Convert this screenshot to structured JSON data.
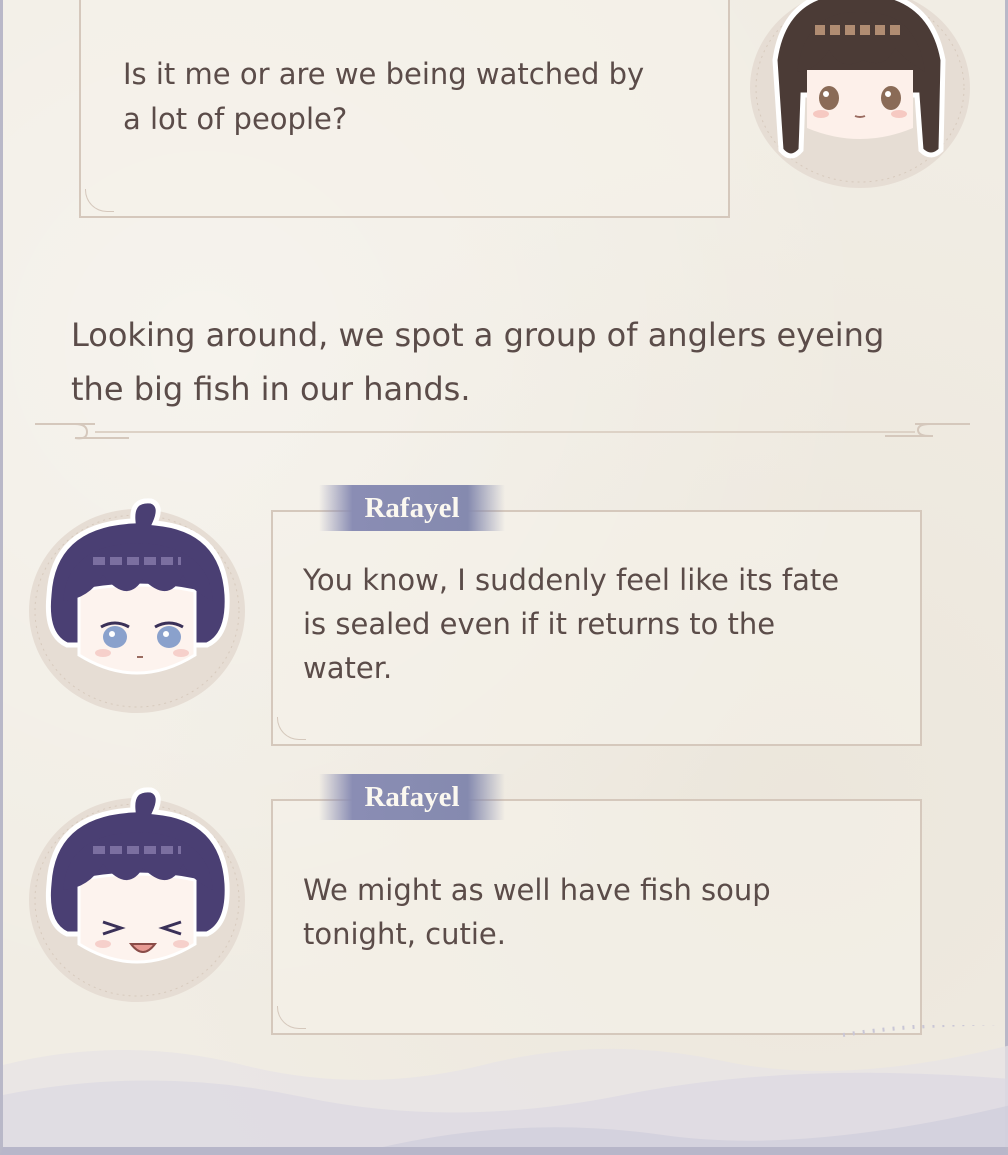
{
  "conversation": {
    "player_line": {
      "text_line_1": "Is it me or are we being watched by",
      "text_line_2": "a lot of people?"
    },
    "narration": {
      "line_1": "Looking around, we spot a group of anglers eyeing",
      "line_2": "the big fish in our hands."
    },
    "rafayel_line_1": {
      "speaker": "Rafayel",
      "text_line_1": "You know, I suddenly feel like its fate",
      "text_line_2": "is sealed even if it returns to the",
      "text_line_3": "water."
    },
    "rafayel_line_2": {
      "speaker": "Rafayel",
      "text_line_1": "We might as well have fish soup",
      "text_line_2": "tonight, cutie."
    }
  },
  "colors": {
    "background": "#f1ede4",
    "text": "#5b4c49",
    "bubble_border": "#d5c8bc",
    "name_tag": "#8a8db4",
    "rafayel_hair": "#4a3f73",
    "player_hair": "#4b3b36"
  }
}
